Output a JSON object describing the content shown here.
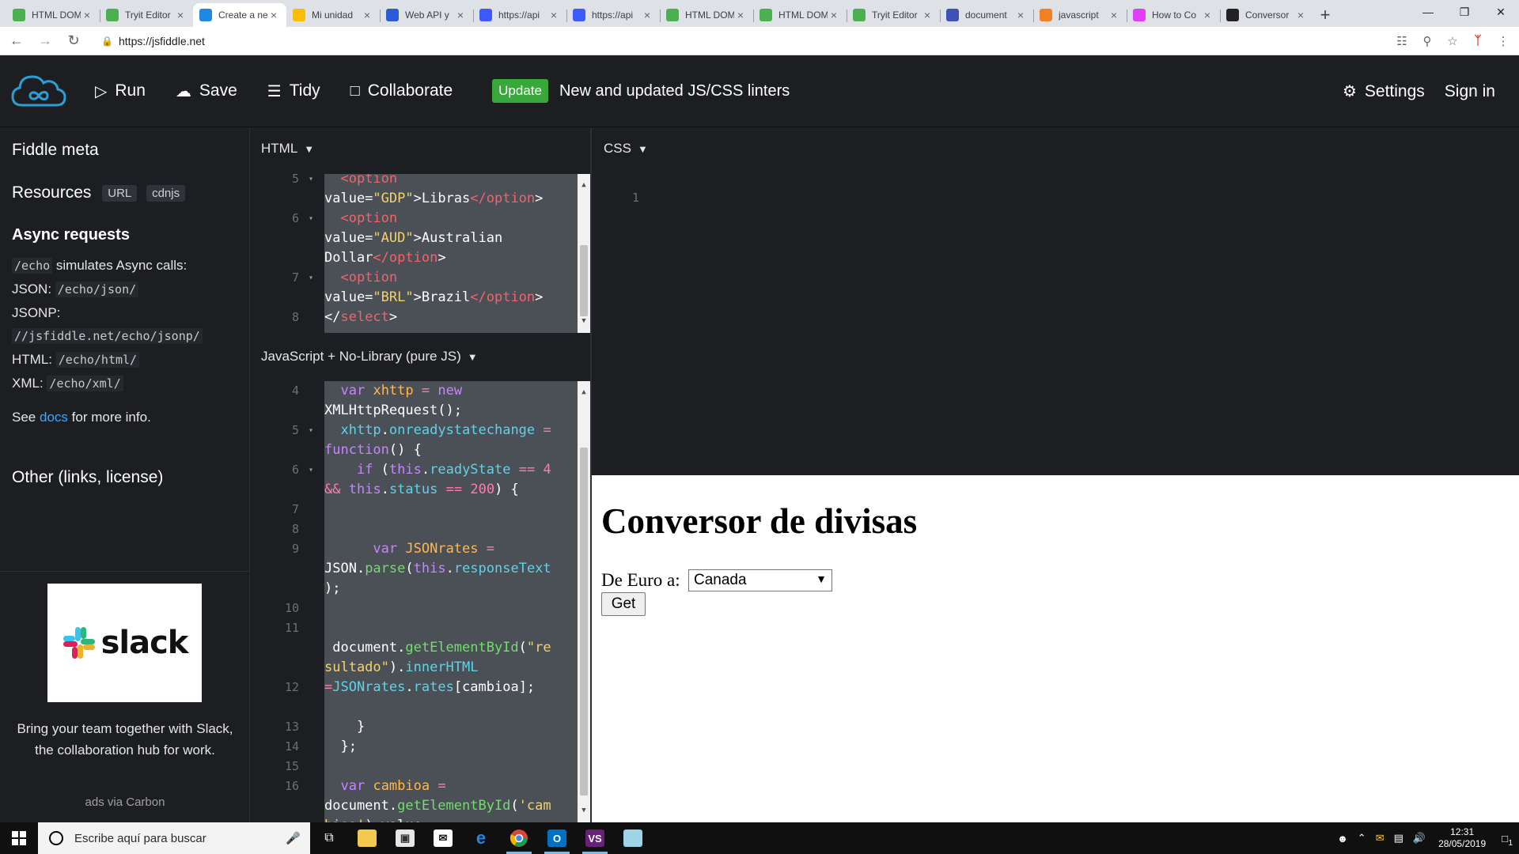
{
  "browser": {
    "tabs": [
      {
        "label": "HTML DOM",
        "fav": "#4caf50",
        "active": false
      },
      {
        "label": "Tryit Editor",
        "fav": "#4caf50",
        "active": false
      },
      {
        "label": "Create a new fiddle",
        "fav": "#1e88e5",
        "active": true
      },
      {
        "label": "Mi unidad",
        "fav": "#fbbc04",
        "active": false
      },
      {
        "label": "Web API y",
        "fav": "#2a5bd7",
        "active": false
      },
      {
        "label": "https://api",
        "fav": "#3d5afe",
        "active": false
      },
      {
        "label": "https://api",
        "fav": "#3d5afe",
        "active": false
      },
      {
        "label": "HTML DOM",
        "fav": "#4caf50",
        "active": false
      },
      {
        "label": "HTML DOM",
        "fav": "#4caf50",
        "active": false
      },
      {
        "label": "Tryit Editor",
        "fav": "#4caf50",
        "active": false
      },
      {
        "label": "document",
        "fav": "#3f51b5",
        "active": false
      },
      {
        "label": "javascript",
        "fav": "#f48024",
        "active": false
      },
      {
        "label": "How to Co",
        "fav": "#e040fb",
        "active": false
      },
      {
        "label": "Conversor",
        "fav": "#222222",
        "active": false
      }
    ],
    "url": "https://jsfiddle.net"
  },
  "header": {
    "run": "Run",
    "save": "Save",
    "tidy": "Tidy",
    "collaborate": "Collaborate",
    "update_badge": "Update",
    "update_text": "New and updated JS/CSS linters",
    "settings": "Settings",
    "signin": "Sign in"
  },
  "sidebar": {
    "fiddle_meta": "Fiddle meta",
    "resources": "Resources",
    "tag_url": "URL",
    "tag_cdnjs": "cdnjs",
    "async_title": "Async requests",
    "echo_code": "/echo",
    "echo_text": "simulates Async calls:",
    "json_label": "JSON:",
    "json_code": "/echo/json/",
    "jsonp_label": "JSONP:",
    "jsonp_code": "//jsfiddle.net/echo/jsonp/",
    "html_label": "HTML:",
    "html_code": "/echo/html/",
    "xml_label": "XML:",
    "xml_code": "/echo/xml/",
    "see": "See",
    "docs": "docs",
    "more_info": "for more info.",
    "other": "Other (links, license)",
    "ad_brand": "slack",
    "ad_text": "Bring your team together with Slack, the collaboration hub for work.",
    "ad_via": "ads via Carbon"
  },
  "panes": {
    "html_label": "HTML",
    "css_label": "CSS",
    "js_label": "JavaScript + No-Library (pure JS)"
  },
  "html_code": {
    "line_numbers": [
      {
        "n": "5",
        "fold": true
      },
      {
        "n": "6",
        "fold": true
      },
      {
        "n": "7",
        "fold": true
      },
      {
        "n": "8",
        "fold": false
      }
    ]
  },
  "css_code": {
    "line_numbers": [
      "1"
    ]
  },
  "js_code": {
    "line_numbers": [
      {
        "n": "4",
        "fold": false
      },
      {
        "n": "5",
        "fold": true
      },
      {
        "n": "6",
        "fold": true
      },
      {
        "n": "7",
        "fold": false
      },
      {
        "n": "8",
        "fold": false
      },
      {
        "n": "9",
        "fold": false
      },
      {
        "n": "10",
        "fold": false
      },
      {
        "n": "11",
        "fold": false
      },
      {
        "n": "12",
        "fold": false
      },
      {
        "n": "13",
        "fold": false
      },
      {
        "n": "14",
        "fold": false
      },
      {
        "n": "15",
        "fold": false
      },
      {
        "n": "16",
        "fold": false
      }
    ]
  },
  "result": {
    "title": "Conversor de divisas",
    "label": "De Euro a:",
    "selected": "Canada",
    "button": "Get"
  },
  "taskbar": {
    "search_placeholder": "Escribe aquí para buscar",
    "time": "12:31",
    "date": "28/05/2019",
    "notifications": "1"
  }
}
